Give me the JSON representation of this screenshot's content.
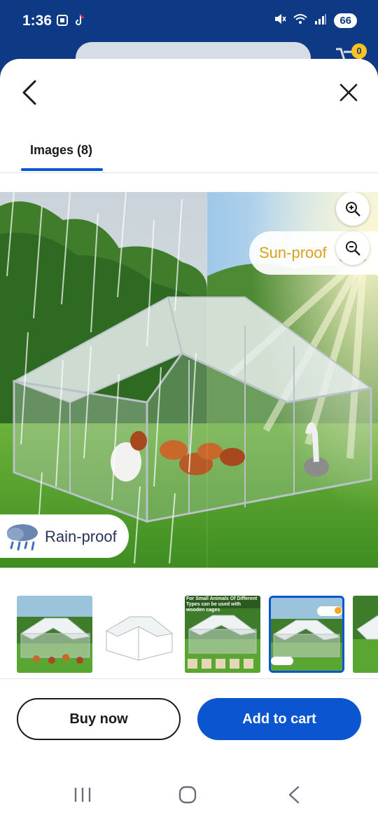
{
  "status_bar": {
    "time": "1:36",
    "battery": "66",
    "icons": [
      "screenshot-icon",
      "tiktok-icon",
      "mute-icon",
      "wifi-icon",
      "signal-icon",
      "battery-icon"
    ]
  },
  "background_app": {
    "cart_count": "0"
  },
  "sheet": {
    "tab_label": "Images (8)",
    "main_image": {
      "sun_label": "Sun-proof",
      "rain_label": "Rain-proof"
    },
    "thumbnails": [
      {
        "caption": ""
      },
      {
        "caption": ""
      },
      {
        "caption": "For Small Animals Of Different Types can be used with wooden cages"
      },
      {
        "caption": ""
      },
      {
        "caption": ""
      }
    ],
    "buttons": {
      "buy_now": "Buy now",
      "add_to_cart": "Add to cart"
    }
  },
  "colors": {
    "brand_blue": "#0b56d0",
    "status_bar_bg": "#0e3a85",
    "sun_text": "#d8a21a"
  }
}
